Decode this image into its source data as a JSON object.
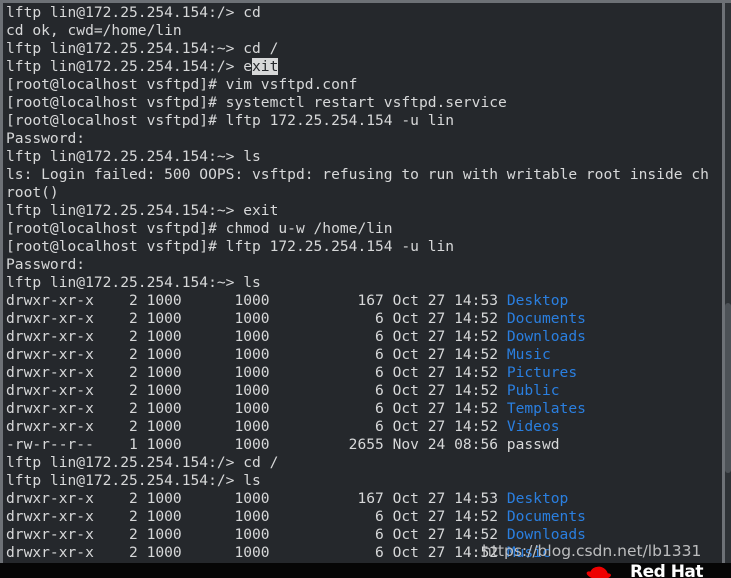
{
  "window": {
    "app": "terminal",
    "background_color": "#25282c",
    "foreground_color": "#d7d8d9",
    "directory_color": "#2a7fe0",
    "selection_bg_color": "#d7d8d9",
    "selection_fg_color": "#25282c",
    "border_color": "#6d7176"
  },
  "terminal": {
    "lines": [
      {
        "id": "l01",
        "segments": [
          {
            "text": "lftp lin@172.25.254.154:/> cd",
            "style": "normal"
          }
        ]
      },
      {
        "id": "l02",
        "segments": [
          {
            "text": "cd ok, cwd=/home/lin",
            "style": "normal"
          }
        ]
      },
      {
        "id": "l03",
        "segments": [
          {
            "text": "lftp lin@172.25.254.154:~> cd /",
            "style": "normal"
          }
        ]
      },
      {
        "id": "l04",
        "segments": [
          {
            "text": "lftp lin@172.25.254.154:/> e",
            "style": "normal"
          },
          {
            "text": "xit",
            "style": "selected"
          }
        ]
      },
      {
        "id": "l05",
        "segments": [
          {
            "text": "[root@localhost vsftpd]# vim vsftpd.conf",
            "style": "normal"
          }
        ]
      },
      {
        "id": "l06",
        "segments": [
          {
            "text": "[root@localhost vsftpd]# systemctl restart vsftpd.service",
            "style": "normal"
          }
        ]
      },
      {
        "id": "l07",
        "segments": [
          {
            "text": "[root@localhost vsftpd]# lftp 172.25.254.154 -u lin",
            "style": "normal"
          }
        ]
      },
      {
        "id": "l08",
        "segments": [
          {
            "text": "Password:",
            "style": "normal"
          }
        ]
      },
      {
        "id": "l09",
        "segments": [
          {
            "text": "lftp lin@172.25.254.154:~> ls",
            "style": "normal"
          }
        ]
      },
      {
        "id": "l10",
        "segments": [
          {
            "text": "ls: Login failed: 500 OOPS: vsftpd: refusing to run with writable root inside ch",
            "style": "normal"
          }
        ]
      },
      {
        "id": "l11",
        "segments": [
          {
            "text": "root()",
            "style": "normal"
          }
        ]
      },
      {
        "id": "l12",
        "segments": [
          {
            "text": "lftp lin@172.25.254.154:~> exit",
            "style": "normal"
          }
        ]
      },
      {
        "id": "l13",
        "segments": [
          {
            "text": "[root@localhost vsftpd]# chmod u-w /home/lin",
            "style": "normal"
          }
        ]
      },
      {
        "id": "l14",
        "segments": [
          {
            "text": "[root@localhost vsftpd]# lftp 172.25.254.154 -u lin",
            "style": "normal"
          }
        ]
      },
      {
        "id": "l15",
        "segments": [
          {
            "text": "Password:",
            "style": "normal"
          }
        ]
      },
      {
        "id": "l16",
        "segments": [
          {
            "text": "lftp lin@172.25.254.154:~> ls",
            "style": "normal"
          }
        ]
      },
      {
        "id": "l17",
        "segments": [
          {
            "text": "drwxr-xr-x    2 1000      1000          167 Oct 27 14:53 ",
            "style": "normal"
          },
          {
            "text": "Desktop",
            "style": "directory"
          }
        ]
      },
      {
        "id": "l18",
        "segments": [
          {
            "text": "drwxr-xr-x    2 1000      1000            6 Oct 27 14:52 ",
            "style": "normal"
          },
          {
            "text": "Documents",
            "style": "directory"
          }
        ]
      },
      {
        "id": "l19",
        "segments": [
          {
            "text": "drwxr-xr-x    2 1000      1000            6 Oct 27 14:52 ",
            "style": "normal"
          },
          {
            "text": "Downloads",
            "style": "directory"
          }
        ]
      },
      {
        "id": "l20",
        "segments": [
          {
            "text": "drwxr-xr-x    2 1000      1000            6 Oct 27 14:52 ",
            "style": "normal"
          },
          {
            "text": "Music",
            "style": "directory"
          }
        ]
      },
      {
        "id": "l21",
        "segments": [
          {
            "text": "drwxr-xr-x    2 1000      1000            6 Oct 27 14:52 ",
            "style": "normal"
          },
          {
            "text": "Pictures",
            "style": "directory"
          }
        ]
      },
      {
        "id": "l22",
        "segments": [
          {
            "text": "drwxr-xr-x    2 1000      1000            6 Oct 27 14:52 ",
            "style": "normal"
          },
          {
            "text": "Public",
            "style": "directory"
          }
        ]
      },
      {
        "id": "l23",
        "segments": [
          {
            "text": "drwxr-xr-x    2 1000      1000            6 Oct 27 14:52 ",
            "style": "normal"
          },
          {
            "text": "Templates",
            "style": "directory"
          }
        ]
      },
      {
        "id": "l24",
        "segments": [
          {
            "text": "drwxr-xr-x    2 1000      1000            6 Oct 27 14:52 ",
            "style": "normal"
          },
          {
            "text": "Videos",
            "style": "directory"
          }
        ]
      },
      {
        "id": "l25",
        "segments": [
          {
            "text": "-rw-r--r--    1 1000      1000         2655 Nov 24 08:56 passwd",
            "style": "normal"
          }
        ]
      },
      {
        "id": "l26",
        "segments": [
          {
            "text": "lftp lin@172.25.254.154:/> cd /",
            "style": "normal"
          }
        ]
      },
      {
        "id": "l27",
        "segments": [
          {
            "text": "lftp lin@172.25.254.154:/> ls",
            "style": "normal"
          }
        ]
      },
      {
        "id": "l28",
        "segments": [
          {
            "text": "drwxr-xr-x    2 1000      1000          167 Oct 27 14:53 ",
            "style": "normal"
          },
          {
            "text": "Desktop",
            "style": "directory"
          }
        ]
      },
      {
        "id": "l29",
        "segments": [
          {
            "text": "drwxr-xr-x    2 1000      1000            6 Oct 27 14:52 ",
            "style": "normal"
          },
          {
            "text": "Documents",
            "style": "directory"
          }
        ]
      },
      {
        "id": "l30",
        "segments": [
          {
            "text": "drwxr-xr-x    2 1000      1000            6 Oct 27 14:52 ",
            "style": "normal"
          },
          {
            "text": "Downloads",
            "style": "directory"
          }
        ]
      },
      {
        "id": "l31",
        "segments": [
          {
            "text": "drwxr-xr-x    2 1000      1000            6 Oct 27 14:52 ",
            "style": "normal"
          },
          {
            "text": "Music",
            "style": "directory"
          }
        ]
      }
    ]
  },
  "watermark": {
    "text": "https://blog.csdn.net/lb1331"
  },
  "branding": {
    "wordmark": "Red Hat",
    "logo_color": "#ee0000",
    "wordmark_color": "#ffffff"
  }
}
